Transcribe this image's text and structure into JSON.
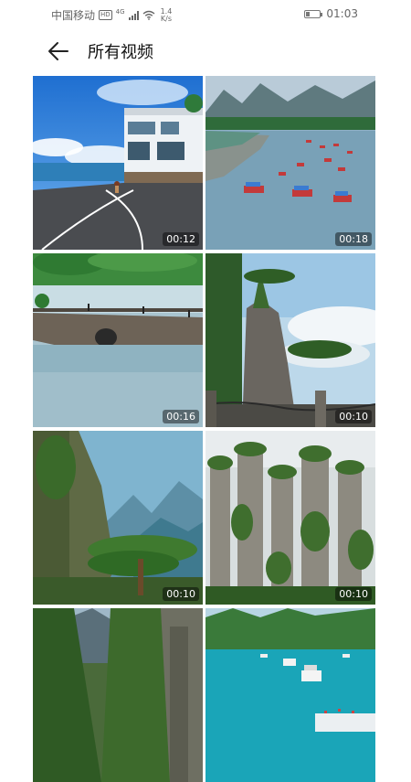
{
  "status_bar": {
    "carrier": "中国移动",
    "hd": "HD",
    "network": "4G",
    "speed_value": "1.4",
    "speed_unit": "K/s",
    "time": "01:03",
    "battery_level": 0.3
  },
  "header": {
    "title": "所有视频",
    "back_icon": "arrow-left-icon"
  },
  "videos": [
    {
      "duration": "00:12",
      "scene": "coastal-road-house"
    },
    {
      "duration": "00:18",
      "scene": "river-bamboo-rafts"
    },
    {
      "duration": "00:16",
      "scene": "stone-bridge-lake"
    },
    {
      "duration": "00:10",
      "scene": "cliff-pine-sea-of-clouds"
    },
    {
      "duration": "00:10",
      "scene": "canyon-pine-mountains"
    },
    {
      "duration": "00:10",
      "scene": "sandstone-pillars-forest"
    },
    {
      "duration": "",
      "scene": "green-gorge-cliffs"
    },
    {
      "duration": "",
      "scene": "lake-cruise-boats"
    }
  ]
}
